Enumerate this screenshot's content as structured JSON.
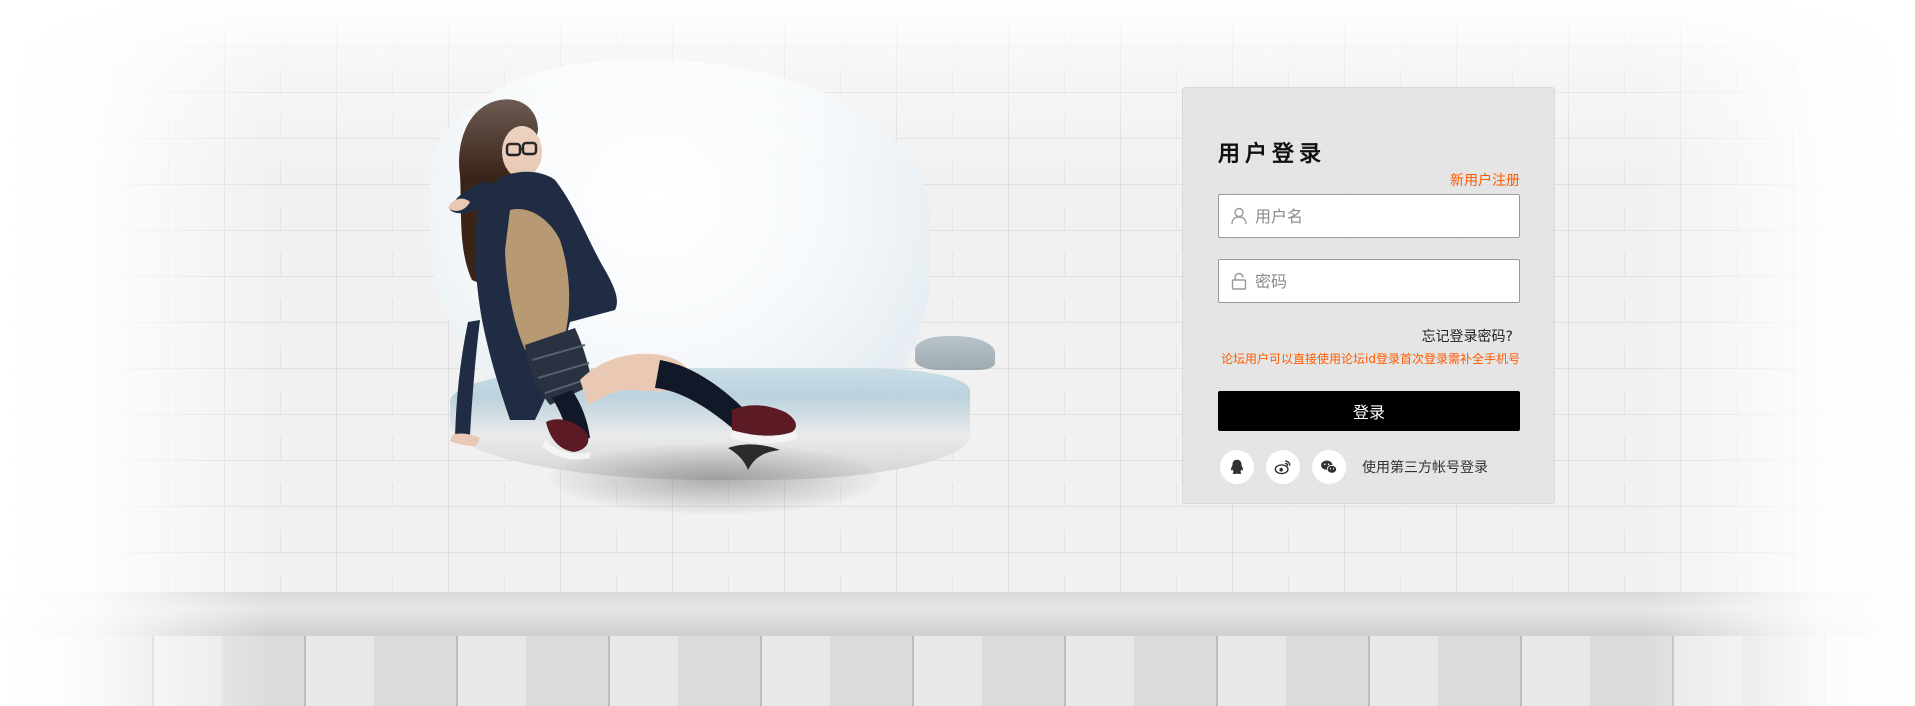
{
  "login": {
    "title": "用户登录",
    "register_link": "新用户注册",
    "username_placeholder": "用户名",
    "password_placeholder": "密码",
    "forgot_link": "忘记登录密码?",
    "forum_note": "论坛用户可以直接使用论坛id登录首次登录需补全手机号",
    "submit_label": "登录",
    "social": {
      "label": "使用第三方帐号登录",
      "providers": [
        "qq-icon",
        "weibo-icon",
        "wechat-icon"
      ]
    }
  },
  "colors": {
    "accent": "#ff5a00",
    "button": "#000000",
    "panel_background": "#e1e1e1"
  }
}
